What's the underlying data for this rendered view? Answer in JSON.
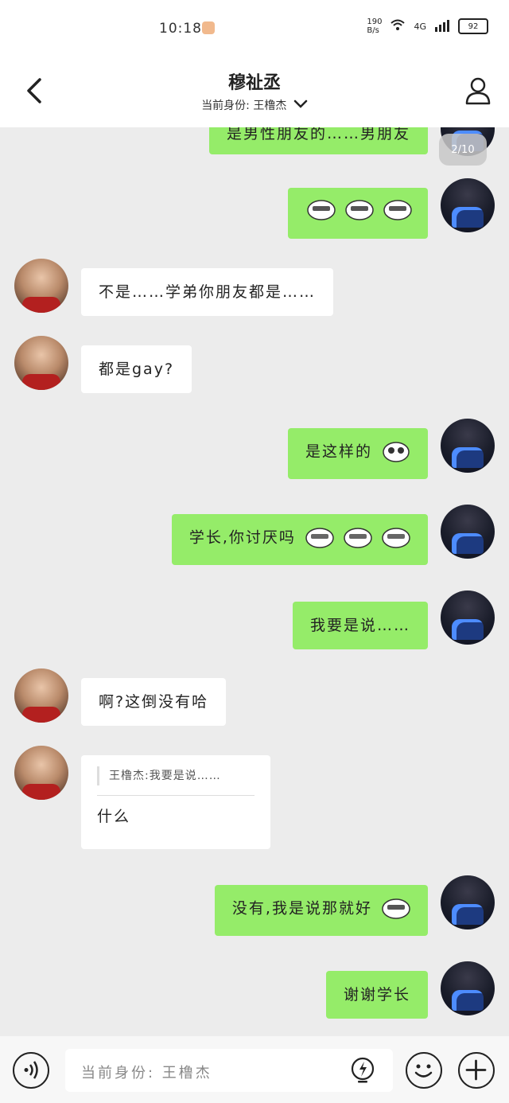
{
  "status_bar": {
    "time": "10:18",
    "net_speed_top": "190",
    "net_speed_bottom": "B/s",
    "signal_label": "4G",
    "battery": "92"
  },
  "header": {
    "title": "穆祉丞",
    "subtitle": "当前身份: 王橹杰"
  },
  "chat": {
    "pager": "2/10",
    "messages": [
      {
        "side": "me",
        "text": "是男性朋友的……男朋友"
      },
      {
        "side": "me",
        "text": ""
      },
      {
        "side": "other",
        "text": "不是……学弟你朋友都是……"
      },
      {
        "side": "other",
        "text": "都是gay?"
      },
      {
        "side": "me",
        "text": "是这样的"
      },
      {
        "side": "me",
        "text": "学长,你讨厌吗"
      },
      {
        "side": "me",
        "text": "我要是说……"
      },
      {
        "side": "other",
        "text": "啊?这倒没有哈"
      },
      {
        "side": "other",
        "quote": "王橹杰:我要是说……",
        "text": "什么"
      },
      {
        "side": "me",
        "text": "没有,我是说那就好"
      },
      {
        "side": "me",
        "text": "谢谢学长"
      }
    ]
  },
  "input": {
    "placeholder": "当前身份: 王橹杰"
  },
  "colors": {
    "my_bubble": "#95ec69",
    "other_bubble": "#ffffff",
    "chat_bg": "#ececec"
  },
  "icons": [
    "back-arrow-icon",
    "profile-icon",
    "chevron-down-icon",
    "voice-icon",
    "lightning-icon",
    "emoji-icon",
    "plus-icon"
  ]
}
